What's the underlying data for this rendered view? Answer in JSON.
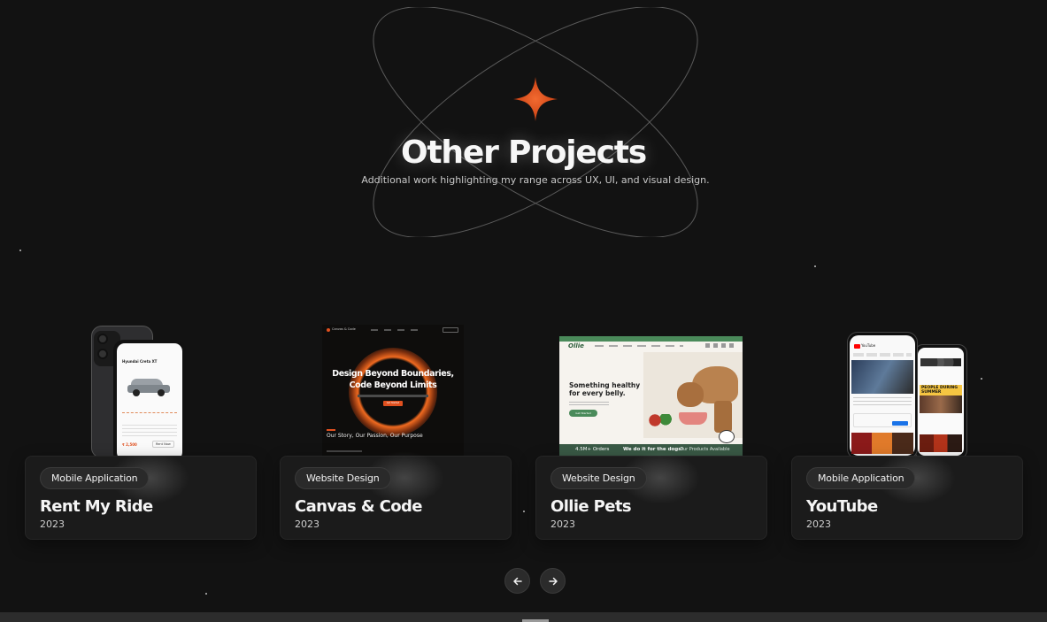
{
  "hero": {
    "title": "Other Projects",
    "subtitle": "Additional work highlighting my range across UX, UI, and visual design.",
    "accent_color": "#e0501f",
    "icon": "four-point-star-icon"
  },
  "projects": [
    {
      "tag": "Mobile Application",
      "title": "Rent My Ride",
      "year": "2023",
      "preview": {
        "car_name": "Hyundai Creta XT",
        "price": "₹ 2,500",
        "cta": "Rent Now"
      }
    },
    {
      "tag": "Website Design",
      "title": "Canvas & Code",
      "year": "2023",
      "preview": {
        "brand": "Canvas & Code",
        "headline_1": "Design Beyond Boundaries,",
        "headline_2": "Code Beyond Limits",
        "section_heading": "Our Story, Our Passion, Our Purpose",
        "cta": "Get Started"
      }
    },
    {
      "tag": "Website Design",
      "title": "Ollie Pets",
      "year": "2023",
      "preview": {
        "brand": "Ollie",
        "headline_1": "Something healthy",
        "headline_2": "for every belly.",
        "stat": "4.5M+ Orders",
        "tagline": "We do it for the dogs!",
        "footer_link": "Our Products Available",
        "cta": "Get Started"
      }
    },
    {
      "tag": "Mobile Application",
      "title": "YouTube",
      "year": "2023",
      "preview": {
        "brand": "YouTube",
        "banner": "PEOPLE DURING SUMMER"
      }
    }
  ],
  "navigation": {
    "prev_icon": "arrow-left-icon",
    "next_icon": "arrow-right-icon"
  }
}
